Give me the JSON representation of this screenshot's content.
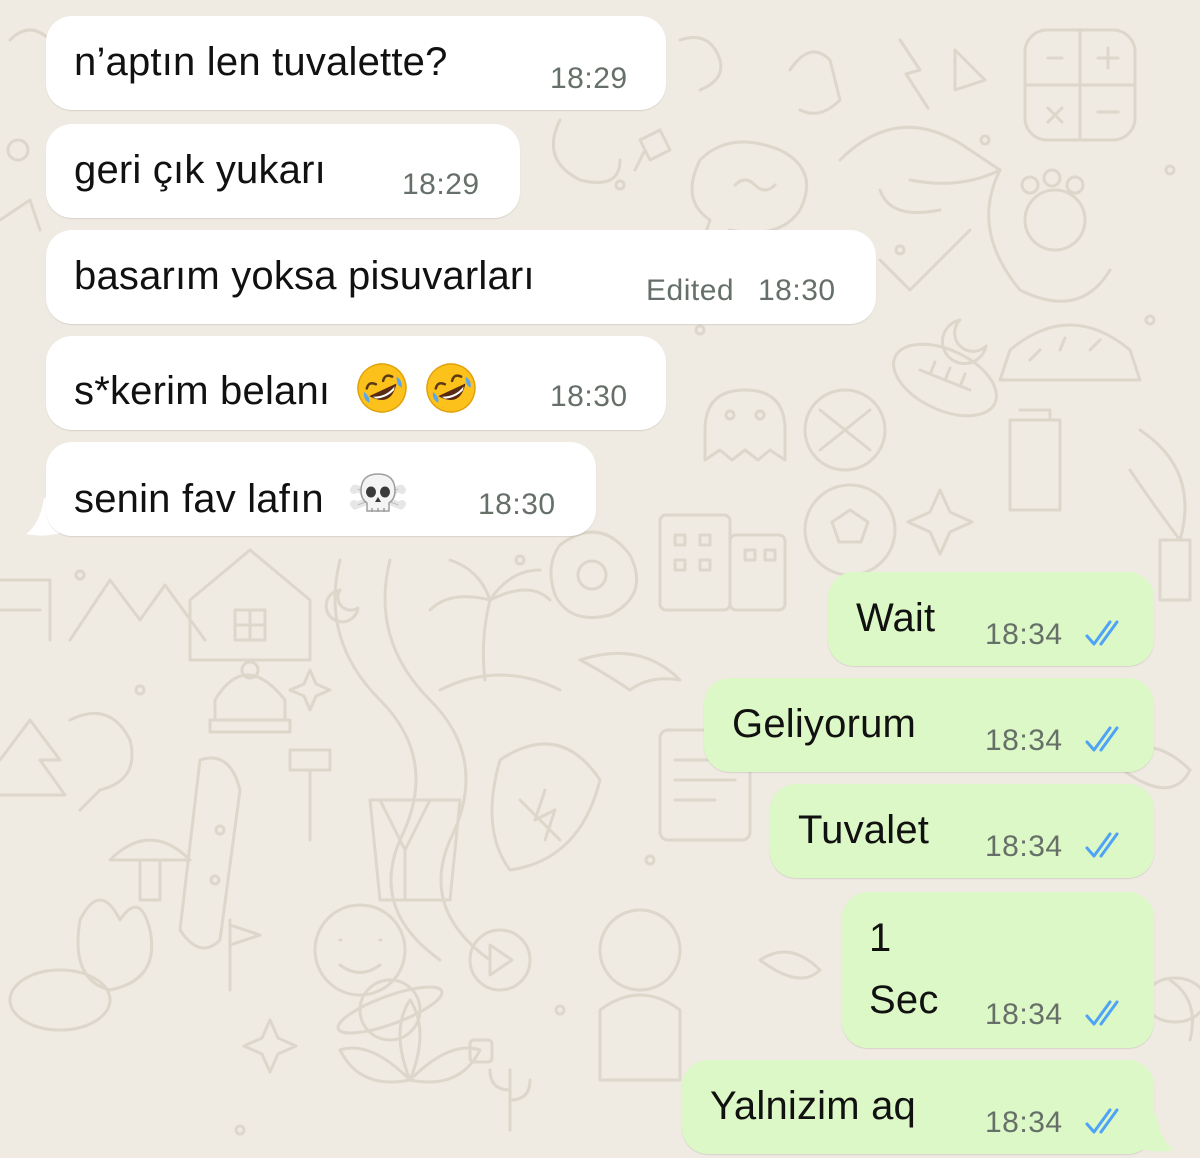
{
  "colors": {
    "wallpaper": "#efeae2",
    "incoming_bubble": "#ffffff",
    "outgoing_bubble": "#dcf8c6",
    "meta_text": "#667069",
    "read_ticks": "#4fa3f7"
  },
  "messages": [
    {
      "direction": "incoming",
      "text": "n’aptın len tuvalette?",
      "time": "18:29"
    },
    {
      "direction": "incoming",
      "text": "geri çık yukarı",
      "time": "18:29"
    },
    {
      "direction": "incoming",
      "text": "basarım yoksa pisuvarları",
      "edited_label": "Edited",
      "time": "18:30"
    },
    {
      "direction": "incoming",
      "text": "s*kerim belanı",
      "emoji": [
        "rolling-on-floor-laughing",
        "rolling-on-floor-laughing"
      ],
      "time": "18:30"
    },
    {
      "direction": "incoming",
      "text": "senin fav lafın",
      "emoji": [
        "skull-and-crossbones"
      ],
      "time": "18:30"
    },
    {
      "direction": "outgoing",
      "text": "Wait",
      "time": "18:34",
      "status": "read"
    },
    {
      "direction": "outgoing",
      "text": "Geliyorum",
      "time": "18:34",
      "status": "read"
    },
    {
      "direction": "outgoing",
      "text": "Tuvalet",
      "time": "18:34",
      "status": "read"
    },
    {
      "direction": "outgoing",
      "lines": [
        "1",
        "Sec"
      ],
      "time": "18:34",
      "status": "read"
    },
    {
      "direction": "outgoing",
      "text": "Yalnizim aq",
      "time": "18:34",
      "status": "read"
    }
  ]
}
